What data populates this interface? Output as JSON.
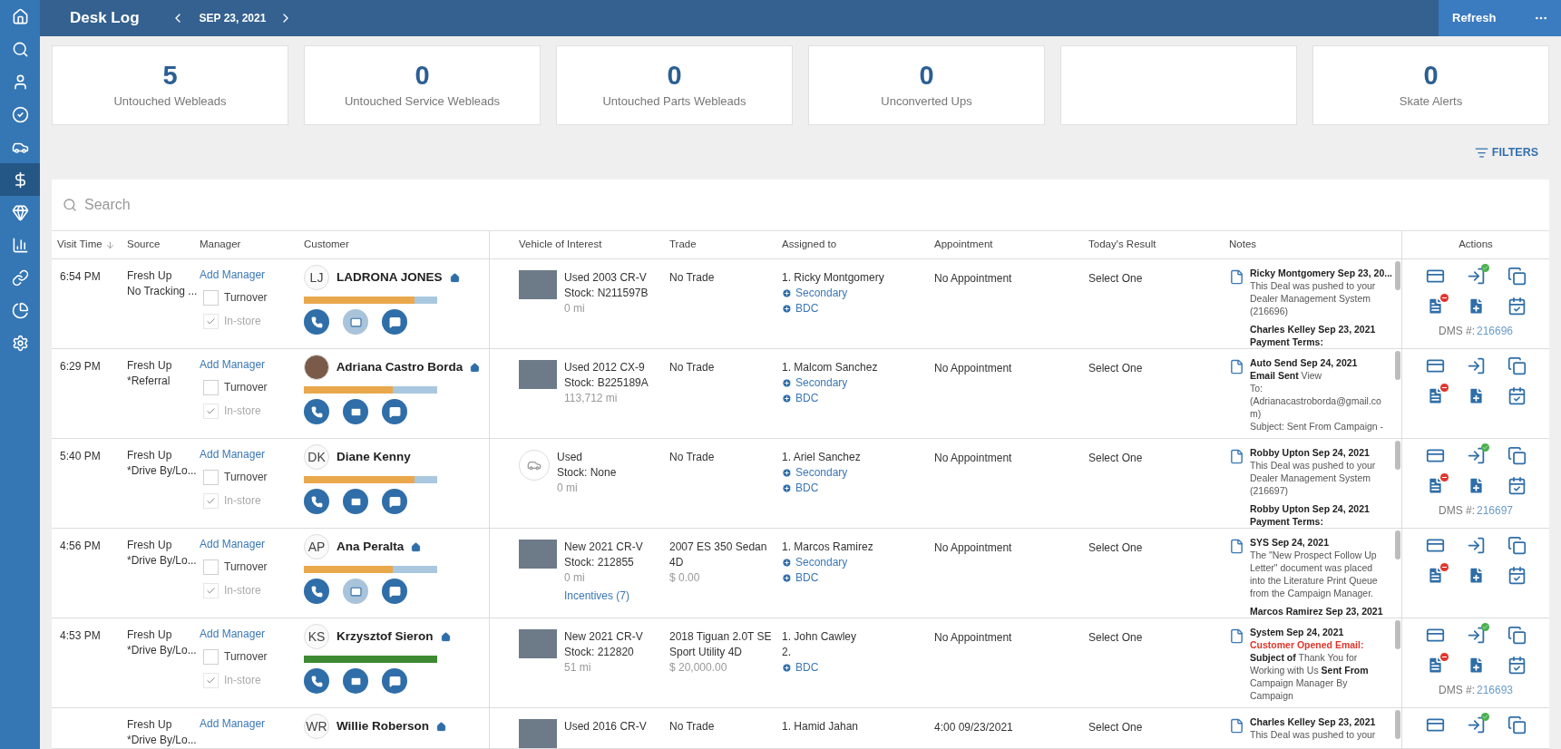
{
  "sidebar": {
    "items": [
      {
        "selected": false
      },
      {
        "selected": false
      },
      {
        "selected": false
      },
      {
        "selected": false
      },
      {
        "selected": false
      },
      {
        "selected": true
      },
      {
        "selected": false
      },
      {
        "selected": false
      },
      {
        "selected": false
      },
      {
        "selected": false
      },
      {
        "selected": false
      }
    ]
  },
  "header": {
    "title": "Desk Log",
    "date": "SEP 23, 2021",
    "refresh": "Refresh"
  },
  "stats": [
    {
      "kind": "count",
      "value": "5",
      "label": "Untouched Webleads"
    },
    {
      "kind": "count",
      "value": "0",
      "label": "Untouched Service Webleads"
    },
    {
      "kind": "count",
      "value": "0",
      "label": "Untouched Parts Webleads"
    },
    {
      "kind": "count",
      "value": "0",
      "label": "Unconverted Ups"
    },
    {
      "kind": "empty"
    },
    {
      "kind": "count",
      "value": "0",
      "label": "Skate Alerts"
    }
  ],
  "filters": "FILTERS",
  "search": {
    "placeholder": "Search"
  },
  "table": {
    "columns": [
      "Visit Time",
      "Source",
      "Manager",
      "Customer",
      "Vehicle of Interest",
      "Trade",
      "Assigned to",
      "Appointment",
      "Today's Result",
      "Notes",
      "Actions"
    ],
    "rows": [
      {
        "cut_off": false,
        "time": "6:54 PM",
        "source": [
          "Fresh Up",
          "No Tracking ..."
        ],
        "manager": {
          "link": "Add Manager",
          "turnover": {
            "label": "Turnover",
            "checked": false
          },
          "in_store": {
            "label": "In-store",
            "checked": true
          }
        },
        "customer": {
          "avatar": {
            "kind": "initials",
            "text": "LJ"
          },
          "name": "LADRONA JONES",
          "home": true,
          "progress": {
            "level": 0.83,
            "color": "#e9a84c"
          },
          "email_enabled": false
        },
        "vehicle": {
          "thumb": {
            "kind": "photo"
          },
          "lines": [
            "Used 2003 CR-V",
            "Stock: N211597B"
          ],
          "mileage": "0 mi"
        },
        "trade": {
          "lines": [
            "No Trade"
          ]
        },
        "assigned": [
          {
            "kind": "text",
            "text": "1. Ricky Montgomery"
          },
          {
            "kind": "add",
            "text": "Secondary"
          },
          {
            "kind": "add",
            "text": "BDC"
          }
        ],
        "appointment": {
          "text": "No Appointment"
        },
        "result": "Select One",
        "notes": [
          {
            "kind": "heading",
            "text": "Ricky Montgomery Sep 23, 20..."
          },
          {
            "kind": "body",
            "text": "This Deal was pushed to your Dealer Management System (216696)"
          },
          {
            "kind": "heading",
            "text": "Charles Kelley Sep 23, 2021"
          },
          {
            "kind": "heading",
            "text": "Payment Terms:"
          }
        ],
        "actions": {
          "synced": true,
          "dms_label": "DMS #:",
          "dms": "216696"
        }
      },
      {
        "cut_off": false,
        "time": "6:29 PM",
        "source": [
          "Fresh Up",
          "*Referral"
        ],
        "manager": {
          "link": "Add Manager",
          "turnover": {
            "label": "Turnover",
            "checked": false
          },
          "in_store": {
            "label": "In-store",
            "checked": true
          }
        },
        "customer": {
          "avatar": {
            "kind": "photo"
          },
          "name": "Adriana Castro Borda",
          "home": true,
          "progress": {
            "level": 0.67,
            "color": "#e9a84c"
          },
          "email_enabled": true
        },
        "vehicle": {
          "thumb": {
            "kind": "photo"
          },
          "lines": [
            "Used 2012 CX-9",
            "Stock: B225189A"
          ],
          "mileage": "113,712 mi"
        },
        "trade": {
          "lines": [
            "No Trade"
          ]
        },
        "assigned": [
          {
            "kind": "text",
            "text": "1. Malcom Sanchez"
          },
          {
            "kind": "add",
            "text": "Secondary"
          },
          {
            "kind": "add",
            "text": "BDC"
          }
        ],
        "appointment": {
          "text": "No Appointment"
        },
        "result": "Select One",
        "notes": [
          {
            "kind": "heading",
            "text": "Auto Send Sep 24, 2021"
          },
          {
            "kind": "body",
            "text": "**Email Sent**  View"
          },
          {
            "kind": "body",
            "text": "To:"
          },
          {
            "kind": "body",
            "text": "(Adrianacastroborda@gmail.com)"
          },
          {
            "kind": "body",
            "text": "Subject: Sent From Campaign -"
          }
        ],
        "actions": {
          "synced": false
        }
      },
      {
        "cut_off": false,
        "time": "5:40 PM",
        "source": [
          "Fresh Up",
          "*Drive By/Lo..."
        ],
        "manager": {
          "link": "Add Manager",
          "turnover": {
            "label": "Turnover",
            "checked": false
          },
          "in_store": {
            "label": "In-store",
            "checked": true
          }
        },
        "customer": {
          "avatar": {
            "kind": "initials",
            "text": "DK"
          },
          "name": "Diane Kenny",
          "home": false,
          "progress": {
            "level": 0.83,
            "color": "#e9a84c"
          },
          "email_enabled": true
        },
        "vehicle": {
          "thumb": {
            "kind": "none"
          },
          "lines": [
            "Used",
            "Stock: None"
          ],
          "mileage": "0 mi"
        },
        "trade": {
          "lines": [
            "No Trade"
          ]
        },
        "assigned": [
          {
            "kind": "text",
            "text": "1. Ariel Sanchez"
          },
          {
            "kind": "add",
            "text": "Secondary"
          },
          {
            "kind": "add",
            "text": "BDC"
          }
        ],
        "appointment": {
          "text": "No Appointment"
        },
        "result": "Select One",
        "notes": [
          {
            "kind": "heading",
            "text": "Robby Upton Sep 24, 2021"
          },
          {
            "kind": "body",
            "text": "This Deal was pushed to your Dealer Management System (216697)"
          },
          {
            "kind": "heading",
            "text": "Robby Upton Sep 24, 2021"
          },
          {
            "kind": "heading",
            "text": "Payment Terms:"
          }
        ],
        "actions": {
          "synced": true,
          "dms_label": "DMS #:",
          "dms": "216697"
        }
      },
      {
        "cut_off": false,
        "time": "4:56 PM",
        "source": [
          "Fresh Up",
          "*Drive By/Lo..."
        ],
        "manager": {
          "link": "Add Manager",
          "turnover": {
            "label": "Turnover",
            "checked": false
          },
          "in_store": {
            "label": "In-store",
            "checked": true
          }
        },
        "customer": {
          "avatar": {
            "kind": "initials",
            "text": "AP"
          },
          "name": "Ana Peralta",
          "home": true,
          "progress": {
            "level": 0.67,
            "color": "#e9a84c"
          },
          "email_enabled": false
        },
        "vehicle": {
          "thumb": {
            "kind": "photo"
          },
          "lines": [
            "New 2021 CR-V",
            "Stock: 212855"
          ],
          "mileage": "0 mi",
          "link": "Incentives (7)"
        },
        "trade": {
          "lines": [
            "2007 ES 350 Sedan 4D"
          ],
          "price": "$ 0.00"
        },
        "assigned": [
          {
            "kind": "text",
            "text": "1. Marcos Ramirez"
          },
          {
            "kind": "add",
            "text": "Secondary"
          },
          {
            "kind": "add",
            "text": "BDC"
          }
        ],
        "appointment": {
          "text": "No Appointment"
        },
        "result": "Select One",
        "notes": [
          {
            "kind": "heading",
            "text": "SYS Sep 24, 2021"
          },
          {
            "kind": "body",
            "text": "The \"New Prospect Follow Up Letter\" document was placed into the Literature Print Queue from the Campaign Manager."
          },
          {
            "kind": "heading",
            "text": "Marcos Ramirez Sep 23, 2021"
          }
        ],
        "actions": {
          "synced": false
        }
      },
      {
        "cut_off": false,
        "time": "4:53 PM",
        "source": [
          "Fresh Up",
          "*Drive By/Lo..."
        ],
        "manager": {
          "link": "Add Manager",
          "turnover": {
            "label": "Turnover",
            "checked": false
          },
          "in_store": {
            "label": "In-store",
            "checked": true
          }
        },
        "customer": {
          "avatar": {
            "kind": "initials",
            "text": "KS"
          },
          "name": "Krzysztof Sieron",
          "home": true,
          "progress": {
            "level": 1,
            "color": "#3d8a33"
          },
          "email_enabled": true
        },
        "vehicle": {
          "thumb": {
            "kind": "photo"
          },
          "lines": [
            "New 2021 CR-V",
            "Stock: 212820"
          ],
          "mileage": "51 mi"
        },
        "trade": {
          "lines": [
            "2018 Tiguan 2.0T SE Sport Utility 4D"
          ],
          "price": "$ 20,000.00"
        },
        "assigned": [
          {
            "kind": "text",
            "text": "1. John Cawley"
          },
          {
            "kind": "text",
            "text": "2."
          },
          {
            "kind": "add",
            "text": "BDC"
          }
        ],
        "appointment": {
          "text": "No Appointment"
        },
        "result": "Select One",
        "notes": [
          {
            "kind": "heading",
            "text": "System Sep 24, 2021"
          },
          {
            "kind": "alert",
            "text": "Customer Opened Email:"
          },
          {
            "kind": "body",
            "text": "**Subject of** Thank You for Working with Us **Sent From** Campaign Manager By Campaign"
          }
        ],
        "actions": {
          "synced": true,
          "dms_label": "DMS #:",
          "dms": "216693"
        }
      },
      {
        "cut_off": true,
        "source": [
          "Fresh Up",
          "*Drive By/Lo..."
        ],
        "manager": {
          "link": "Add Manager"
        },
        "customer": {
          "avatar": {
            "kind": "initials",
            "text": "WR"
          },
          "name": "Willie Roberson",
          "home": true
        },
        "vehicle": {
          "thumb": {
            "kind": "photo"
          },
          "lines": [
            "Used 2016 CR-V"
          ]
        },
        "trade": {
          "lines": [
            "No Trade"
          ]
        },
        "assigned": [
          {
            "kind": "text",
            "text": "1. Hamid Jahan"
          }
        ],
        "appointment": {
          "text": "4:00 09/23/2021"
        },
        "result": "Select One",
        "notes": [
          {
            "kind": "heading",
            "text": "Charles Kelley Sep 23, 2021"
          },
          {
            "kind": "body",
            "text": "This Deal was pushed to your"
          }
        ],
        "actions": {
          "synced": true
        }
      }
    ]
  }
}
